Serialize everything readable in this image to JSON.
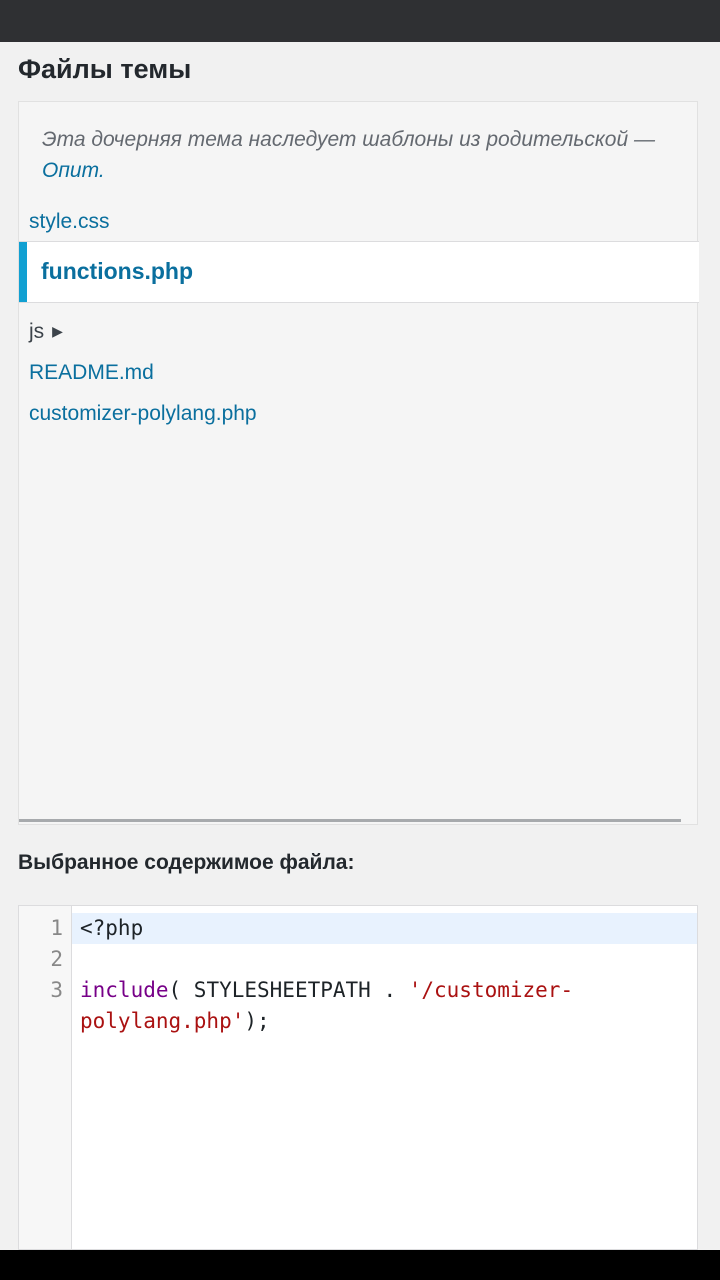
{
  "page": {
    "heading": "Файлы темы",
    "inherit_note": "Эта дочерняя тема наследует шаблоны из родительской —",
    "parent_theme": "Опит."
  },
  "files": {
    "style_css": "style.css",
    "active": "functions.php",
    "folder_js": "js",
    "readme": "README.md",
    "customizer": "customizer-polylang.php"
  },
  "content": {
    "label": "Выбранное содержимое файла:",
    "line_numbers": [
      "1",
      "2",
      "3"
    ],
    "line1": "<?php",
    "line3_keyword": "include",
    "line3_paren": "( STYLESHEETPATH . ",
    "line3_string_a": "'/customizer-",
    "line3_string_b": "polylang.php'",
    "line3_end": ");"
  },
  "colors": {
    "link": "#0a6f9e",
    "active_marker": "#11a0d2",
    "top_bar": "#2f3033",
    "keyword": "#770088",
    "string": "#aa1111"
  },
  "icons": {
    "folder_expand": "triangle-right-icon"
  }
}
